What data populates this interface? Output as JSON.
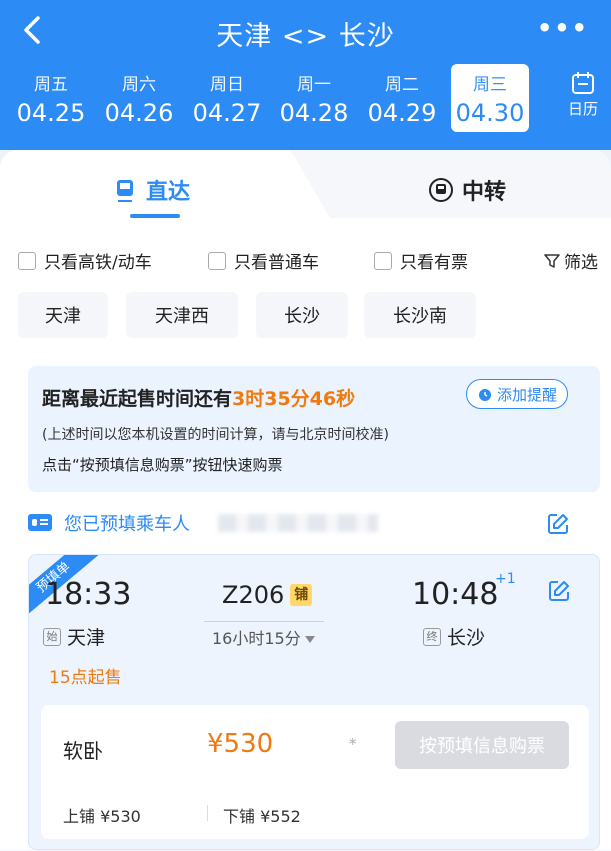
{
  "header": {
    "title": "天津 <> 长沙",
    "more": "•••",
    "calendar_label": "日历"
  },
  "dates": [
    {
      "weekday": "周五",
      "date": "04.25",
      "active": false
    },
    {
      "weekday": "周六",
      "date": "04.26",
      "active": false
    },
    {
      "weekday": "周日",
      "date": "04.27",
      "active": false
    },
    {
      "weekday": "周一",
      "date": "04.28",
      "active": false
    },
    {
      "weekday": "周二",
      "date": "04.29",
      "active": false
    },
    {
      "weekday": "周三",
      "date": "04.30",
      "active": true
    }
  ],
  "tabs": {
    "direct": "直达",
    "transfer": "中转"
  },
  "filters": {
    "highspeed": "只看高铁/动车",
    "normal": "只看普通车",
    "available": "只看有票",
    "filter": "筛选"
  },
  "stations": [
    "天津",
    "天津西",
    "长沙",
    "长沙南"
  ],
  "sale_notice": {
    "prefix": "距离最近起售时间还有",
    "countdown": "3时35分46秒",
    "remind": "添加提醒",
    "note": "(上述时间以您本机设置的时间计算，请与北京时间校准)",
    "hint": "点击“按预填信息购票”按钮快速购票"
  },
  "passenger": {
    "label": "您已预填乘车人"
  },
  "train": {
    "ribbon": "预填单",
    "dep_time": "18:33",
    "dep_tag": "始",
    "dep_station": "天津",
    "train_no": "Z206",
    "berth_tag": "铺",
    "duration": "16小时15分",
    "arr_time": "10:48",
    "arr_plus": "+1",
    "arr_tag": "终",
    "arr_station": "长沙",
    "sale_start": "15点起售",
    "seat": {
      "name": "软卧",
      "price": "¥530",
      "star": "*",
      "buy": "按预填信息购票",
      "upper": "上铺 ¥530",
      "lower": "下铺 ¥552"
    }
  },
  "colors": {
    "primary": "#2c8bf5",
    "accent": "#f07a10"
  }
}
